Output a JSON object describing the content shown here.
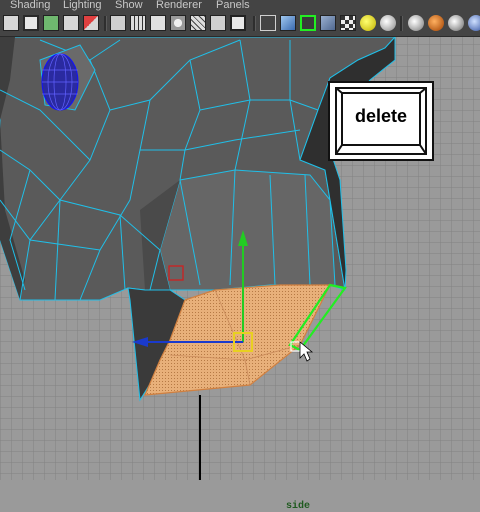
{
  "menubar": {
    "items": [
      {
        "label": "Shading"
      },
      {
        "label": "Lighting"
      },
      {
        "label": "Show"
      },
      {
        "label": "Renderer"
      },
      {
        "label": "Panels"
      }
    ]
  },
  "viewport": {
    "camera_label": "side"
  },
  "overlay": {
    "key_label": "delete"
  },
  "colors": {
    "ui_bg": "#444444",
    "grid_bg": "#9a9a9a",
    "wire": "#3ad0ff",
    "selected_face": "#f0b070",
    "selected_edge": "#22ee22",
    "manip_y": "#22cc22",
    "manip_x": "#1a3acc",
    "manip_center": "#e8d020"
  }
}
